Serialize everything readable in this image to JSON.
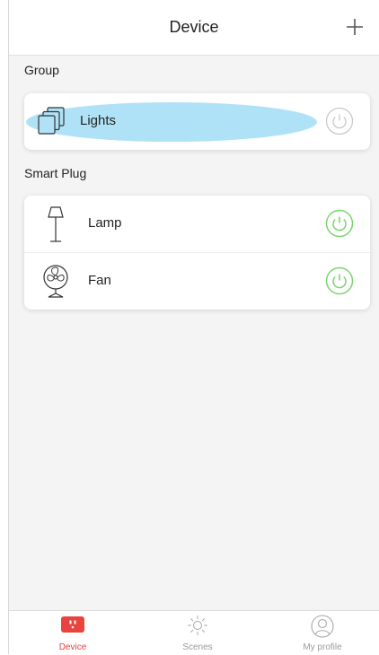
{
  "header": {
    "title": "Device",
    "add_icon": "plus-icon"
  },
  "sections": [
    {
      "label": "Group"
    },
    {
      "label": "Smart Plug"
    }
  ],
  "group_items": [
    {
      "label": "Lights",
      "icon": "layers-icon",
      "power_state": "off"
    }
  ],
  "plug_items": [
    {
      "label": "Lamp",
      "icon": "floor-lamp-icon",
      "power_state": "on"
    },
    {
      "label": "Fan",
      "icon": "fan-icon",
      "power_state": "on"
    }
  ],
  "tabs": [
    {
      "label": "Device",
      "icon": "smart-plug-icon",
      "active": true
    },
    {
      "label": "Scenes",
      "icon": "sun-icon",
      "active": false
    },
    {
      "label": "My profile",
      "icon": "user-icon",
      "active": false
    }
  ],
  "colors": {
    "power_on": "#78d56b",
    "power_off": "#c9c9c9",
    "accent": "#e8433d",
    "highlight": "#b0e2f7"
  }
}
